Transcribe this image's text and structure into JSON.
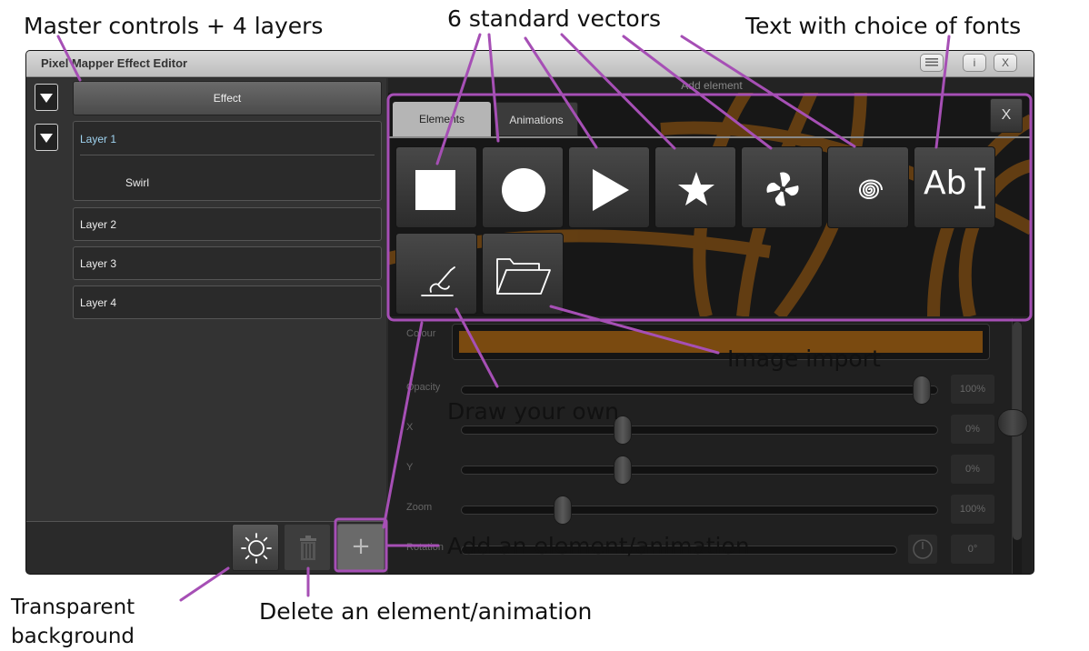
{
  "annotations": {
    "master_layers": "Master controls + 4 layers",
    "standard_vectors": "6 standard vectors",
    "text_fonts": "Text with choice of fonts",
    "image_import": "Image import",
    "draw_own": "Draw your own",
    "add_element": "Add an element/animation",
    "delete_element": "Delete an element/animation",
    "transparent_bg": "Transparent background"
  },
  "window": {
    "title": "Pixel Mapper Effect Editor",
    "info_label": "i",
    "close_label": "X"
  },
  "left": {
    "effect_label": "Effect",
    "layers": [
      {
        "label": "Layer 1",
        "sub": "Swirl"
      },
      {
        "label": "Layer 2"
      },
      {
        "label": "Layer 3"
      },
      {
        "label": "Layer 4"
      }
    ]
  },
  "bottom": {
    "add_label": "+"
  },
  "dialog": {
    "title": "Add element",
    "tabs": [
      "Elements",
      "Animations"
    ],
    "close_label": "X",
    "text_button_label": "Ab"
  },
  "properties": {
    "colour_label": "Colour",
    "colour_value": "#7a4a10",
    "opacity_label": "Opacity",
    "opacity_value": "100%",
    "x_label": "X",
    "x_value": "0%",
    "y_label": "Y",
    "y_value": "0%",
    "zoom_label": "Zoom",
    "zoom_value": "100%",
    "rotation_label": "Rotation",
    "rotation_value": "0°"
  },
  "colors": {
    "highlight": "#a64fb5",
    "orange": "#7a4a10"
  },
  "icons": [
    "square-icon",
    "circle-icon",
    "play-triangle-icon",
    "star-icon",
    "pinwheel-icon",
    "spiral-icon",
    "text-cursor-icon",
    "draw-hand-icon",
    "folder-icon",
    "sun-icon",
    "trash-icon",
    "plus-icon"
  ]
}
